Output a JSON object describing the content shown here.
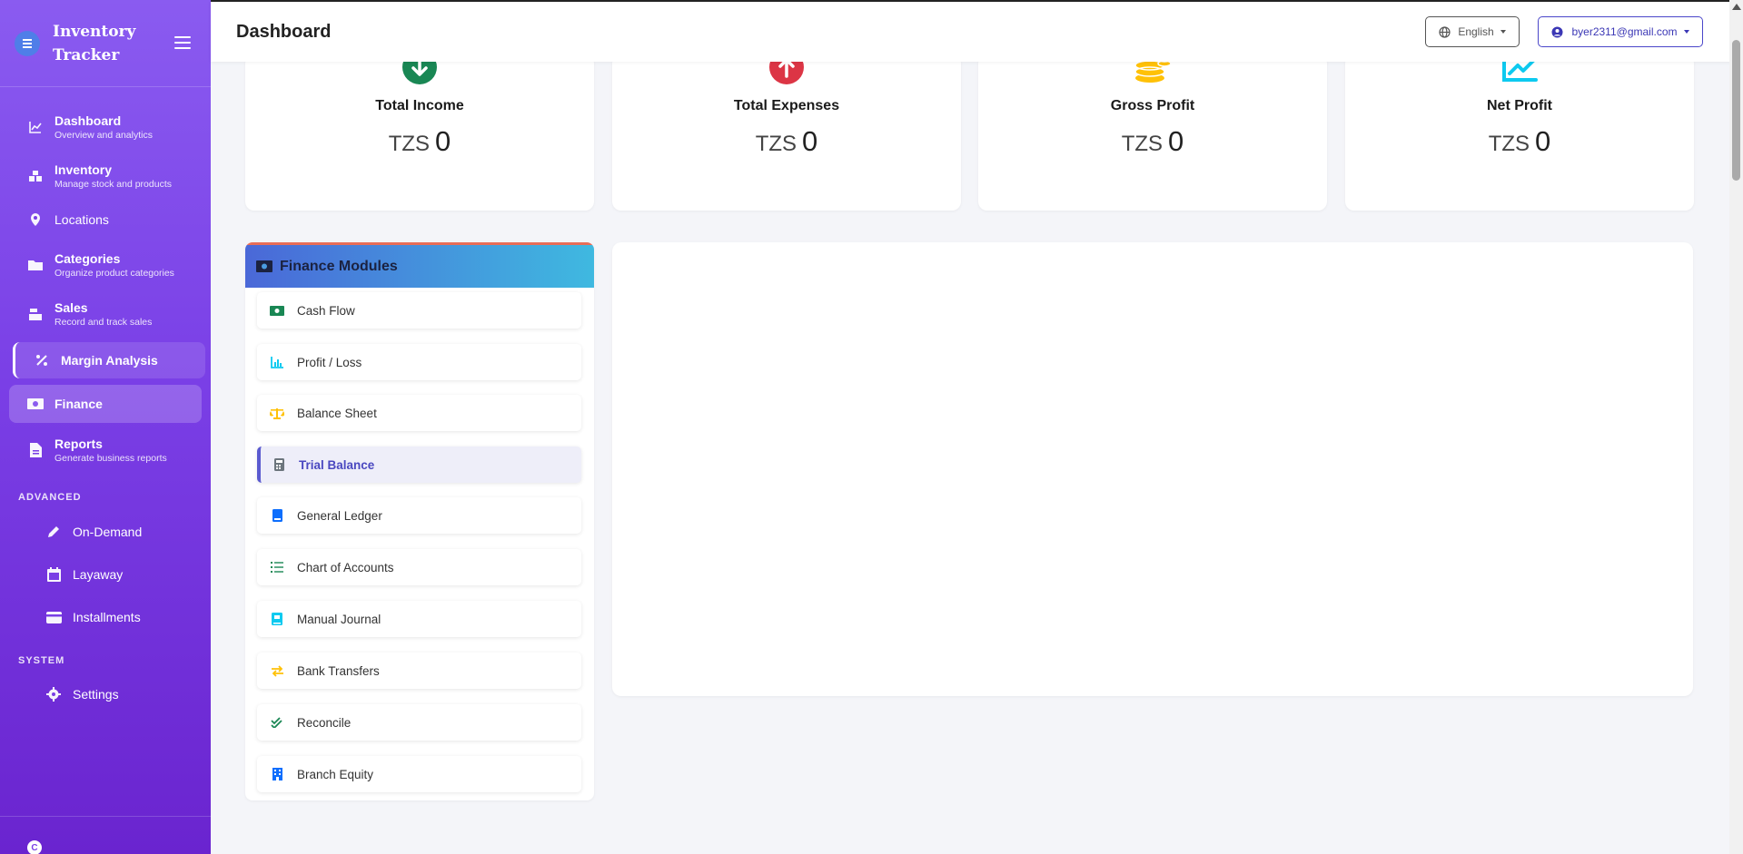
{
  "brand": {
    "title": "Inventory Tracker",
    "icon": "layers-icon"
  },
  "sidebar": {
    "items": [
      {
        "label": "Dashboard",
        "sub": "Overview and analytics",
        "icon": "chart-line-icon"
      },
      {
        "label": "Inventory",
        "sub": "Manage stock and products",
        "icon": "boxes-icon"
      },
      {
        "label": "Locations",
        "sub": "",
        "icon": "map-pin-icon"
      },
      {
        "label": "Categories",
        "sub": "Organize product categories",
        "icon": "folder-icon"
      },
      {
        "label": "Sales",
        "sub": "Record and track sales",
        "icon": "cash-register-icon"
      },
      {
        "label": "Margin Analysis",
        "sub": "",
        "icon": "percent-icon"
      },
      {
        "label": "Finance",
        "sub": "",
        "icon": "money-bill-icon"
      },
      {
        "label": "Reports",
        "sub": "Generate business reports",
        "icon": "file-icon"
      }
    ],
    "advanced_label": "ADVANCED",
    "advanced": [
      {
        "label": "On-Demand",
        "icon": "pencil-icon"
      },
      {
        "label": "Layaway",
        "icon": "calendar-icon"
      },
      {
        "label": "Installments",
        "icon": "credit-card-icon"
      }
    ],
    "system_label": "SYSTEM",
    "system": [
      {
        "label": "Settings",
        "icon": "gear-icon"
      }
    ],
    "footer_badge": "C"
  },
  "header": {
    "title": "Dashboard",
    "language": "English",
    "user": "byer2311@gmail.com"
  },
  "stats": [
    {
      "title": "Total Income",
      "currency": "TZS",
      "value": "0",
      "icon": "arrow-down-circle-icon",
      "color": "#198754"
    },
    {
      "title": "Total Expenses",
      "currency": "TZS",
      "value": "0",
      "icon": "arrow-up-circle-icon",
      "color": "#dc3545"
    },
    {
      "title": "Gross Profit",
      "currency": "TZS",
      "value": "0",
      "icon": "coins-icon",
      "color": "#ffc107"
    },
    {
      "title": "Net Profit",
      "currency": "TZS",
      "value": "0",
      "icon": "chart-line-up-icon",
      "color": "#0dcaf0"
    }
  ],
  "finance_modules": {
    "title": "Finance Modules",
    "items": [
      {
        "label": "Cash Flow",
        "icon": "money-bill-wave-icon",
        "color": "#198754"
      },
      {
        "label": "Profit / Loss",
        "icon": "chart-bar-icon",
        "color": "#0dcaf0"
      },
      {
        "label": "Balance Sheet",
        "icon": "scale-icon",
        "color": "#ffc107"
      },
      {
        "label": "Trial Balance",
        "icon": "calculator-icon",
        "color": "#6c757d",
        "active": true
      },
      {
        "label": "General Ledger",
        "icon": "book-icon",
        "color": "#0d6efd"
      },
      {
        "label": "Chart of Accounts",
        "icon": "list-icon",
        "color": "#198754"
      },
      {
        "label": "Manual Journal",
        "icon": "journal-icon",
        "color": "#0dcaf0"
      },
      {
        "label": "Bank Transfers",
        "icon": "exchange-icon",
        "color": "#ffc107"
      },
      {
        "label": "Reconcile",
        "icon": "double-check-icon",
        "color": "#198754"
      },
      {
        "label": "Branch Equity",
        "icon": "building-icon",
        "color": "#0d6efd"
      }
    ]
  }
}
